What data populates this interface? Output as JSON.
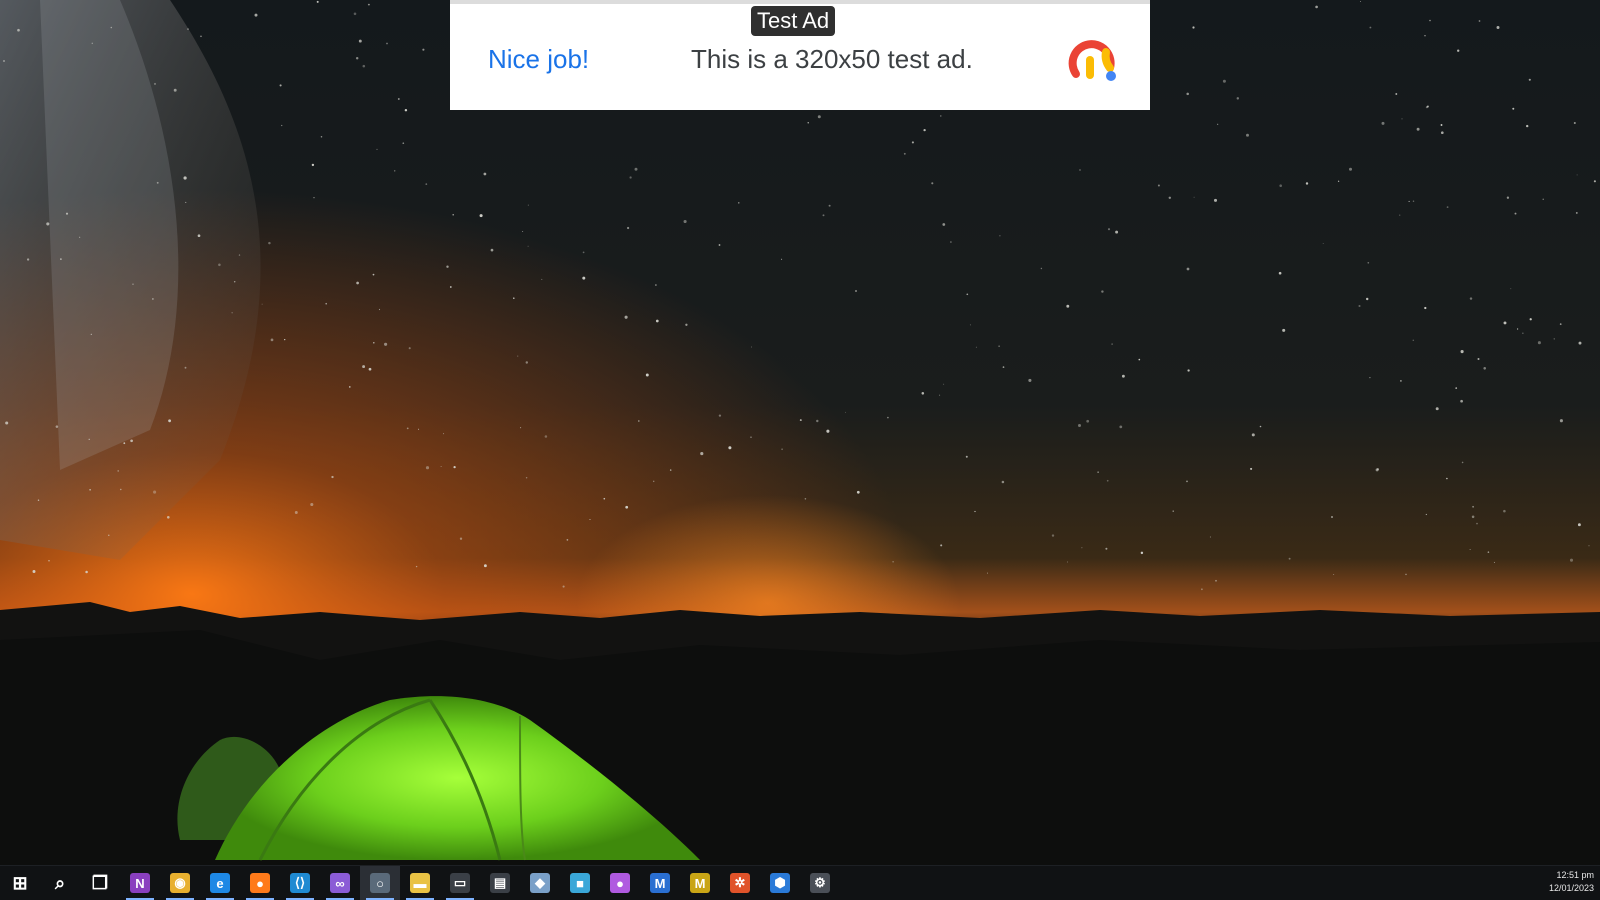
{
  "ad": {
    "badge": "Test Ad",
    "headline": "Nice job!",
    "body": "This is a 320x50 test ad.",
    "logo_icon": "google-admob-icon",
    "headline_color": "#1a73e8"
  },
  "wallpaper": {
    "scene": "night-sky-tent",
    "sky_color": "#12171b",
    "horizon_color": "#e86a10",
    "tent_color": "#7ed321"
  },
  "taskbar": {
    "items": [
      {
        "name": "start",
        "icon": "windows-start-icon",
        "glyph": "⊞",
        "color": "#ffffff"
      },
      {
        "name": "search",
        "icon": "search-icon",
        "glyph": "⌕",
        "color": "#ffffff"
      },
      {
        "name": "task-view",
        "icon": "task-view-icon",
        "glyph": "❐",
        "color": "#ffffff"
      },
      {
        "name": "onenote",
        "icon": "onenote-icon",
        "glyph": "N",
        "color": "#8a3fbf"
      },
      {
        "name": "chrome",
        "icon": "chrome-icon",
        "glyph": "◉",
        "color": "#e8b02f"
      },
      {
        "name": "edge",
        "icon": "edge-icon",
        "glyph": "e",
        "color": "#1e88e5"
      },
      {
        "name": "firefox",
        "icon": "firefox-icon",
        "glyph": "●",
        "color": "#ff7a1a"
      },
      {
        "name": "vscode",
        "icon": "vscode-icon",
        "glyph": "⟨⟩",
        "color": "#1f8ad2"
      },
      {
        "name": "visual-studio",
        "icon": "visual-studio-icon",
        "glyph": "∞",
        "color": "#8b5cd6"
      },
      {
        "name": "app-circle",
        "icon": "app-circle-icon",
        "glyph": "○",
        "color": "#5a6a7a"
      },
      {
        "name": "file-explorer",
        "icon": "file-explorer-icon",
        "glyph": "▬",
        "color": "#e9c244"
      },
      {
        "name": "terminal",
        "icon": "terminal-icon",
        "glyph": "▭",
        "color": "#3a3f46"
      },
      {
        "name": "command-prompt",
        "icon": "command-prompt-icon",
        "glyph": "▤",
        "color": "#3a3f46"
      },
      {
        "name": "app-dolphin",
        "icon": "app-dolphin-icon",
        "glyph": "◆",
        "color": "#7aa0c8"
      },
      {
        "name": "app-cube",
        "icon": "app-cube-icon",
        "glyph": "■",
        "color": "#3aa7d8"
      },
      {
        "name": "app-duo",
        "icon": "app-duo-icon",
        "glyph": "●",
        "color": "#b05ae0"
      },
      {
        "name": "app-m-blue",
        "icon": "app-m-blue-icon",
        "glyph": "M",
        "color": "#2a6fd1"
      },
      {
        "name": "app-m-yellow",
        "icon": "app-m-yellow-icon",
        "glyph": "M",
        "color": "#c9a516"
      },
      {
        "name": "app-orange",
        "icon": "app-orange-icon",
        "glyph": "✲",
        "color": "#e0532a"
      },
      {
        "name": "app-shield",
        "icon": "app-shield-icon",
        "glyph": "⬢",
        "color": "#2a7ad8"
      },
      {
        "name": "settings",
        "icon": "gear-icon",
        "glyph": "⚙",
        "color": "#4a4f57"
      }
    ],
    "clock": {
      "time": "12:51 pm",
      "date": "12/01/2023"
    }
  }
}
